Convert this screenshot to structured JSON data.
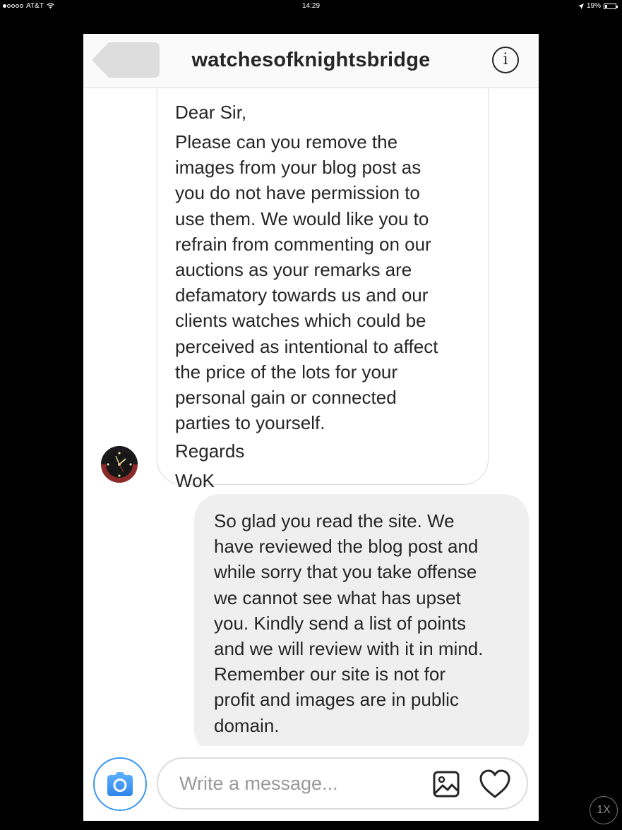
{
  "status_bar": {
    "carrier": "AT&T",
    "time": "14:29",
    "battery": "19%",
    "battery_level": 0.19,
    "signal_bars": 1
  },
  "header": {
    "title": "watchesofknightsbridge",
    "back_icon": "back-arrow-icon",
    "info_icon": "info-icon",
    "info_glyph": "i"
  },
  "messages": {
    "incoming": {
      "greeting": "Dear Sir,",
      "body": "Please can you remove the\nimages from your blog post as\nyou do not have permission to\nuse them. We would like you to\nrefrain from commenting on our\nauctions as your remarks are\ndefamatory towards us and our\nclients watches which could be\nperceived as intentional to affect\nthe price of the lots for your\npersonal gain or connected\nparties to yourself.",
      "closing": "Regards",
      "signature": "WoK",
      "avatar_icon": "watch-avatar"
    },
    "outgoing": {
      "body": "So glad you read the site. We\nhave reviewed the blog post and\nwhile sorry that you take offense\nwe cannot see what has upset\nyou. Kindly send a list of points\nand we will review with it in mind.\nRemember our site is not for\nprofit and images are in public\ndomain."
    }
  },
  "composer": {
    "placeholder": "Write a message...",
    "camera_icon": "camera-icon",
    "gallery_icon": "image-icon",
    "like_icon": "heart-icon"
  },
  "overlay": {
    "zoom_label": "1X"
  },
  "colors": {
    "accent": "#3897f0",
    "text": "#262626",
    "outgoing_bubble": "#efefef",
    "border": "#dbdbdb"
  }
}
